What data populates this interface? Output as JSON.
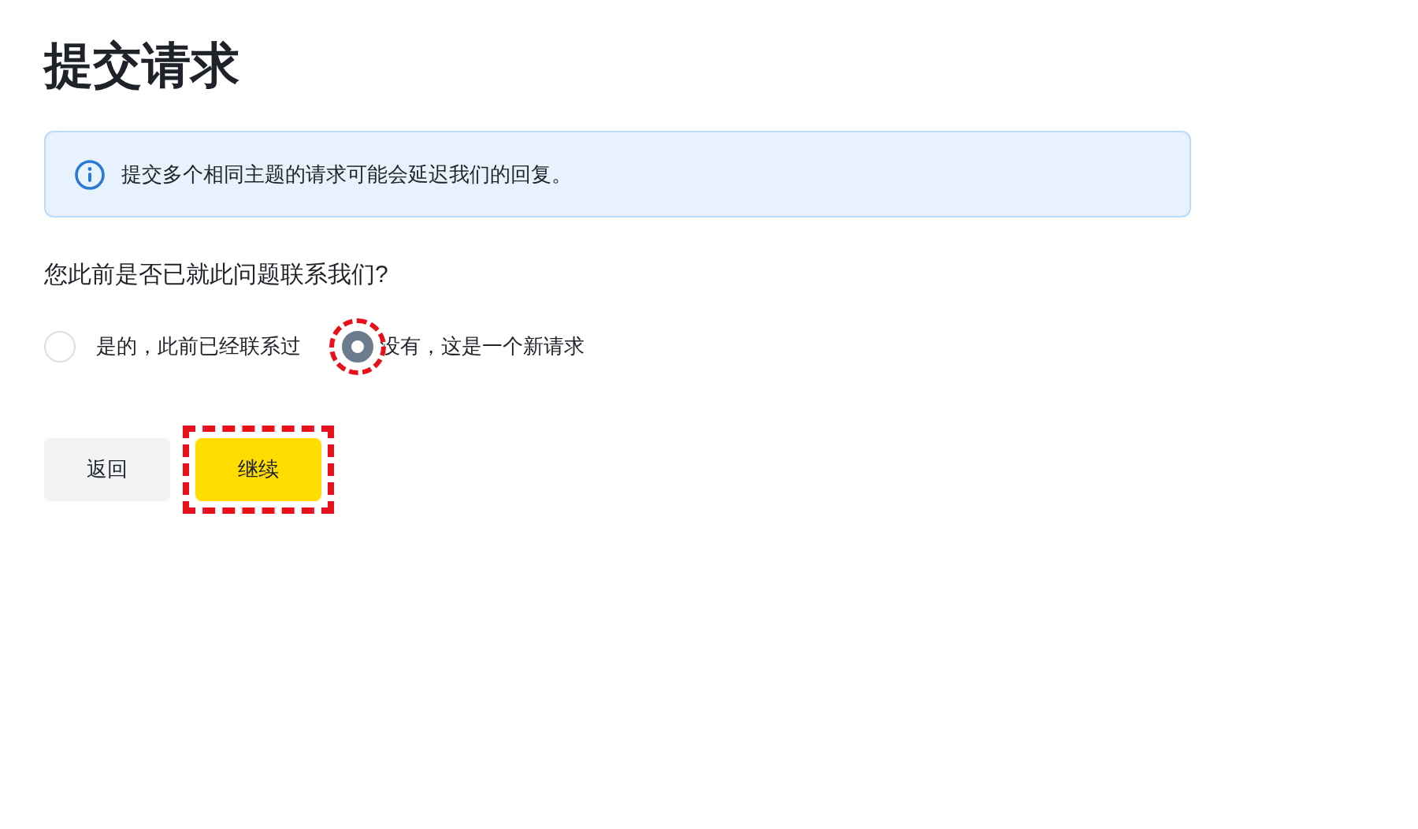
{
  "title": "提交请求",
  "notice": {
    "text": "提交多个相同主题的请求可能会延迟我们的回复。"
  },
  "question": {
    "label": "您此前是否已就此问题联系我们?",
    "options": [
      {
        "label": "是的，此前已经联系过",
        "selected": false,
        "highlighted": false
      },
      {
        "label": "没有，这是一个新请求",
        "selected": true,
        "highlighted": true
      }
    ]
  },
  "buttons": [
    {
      "label": "返回",
      "kind": "secondary",
      "highlighted": false
    },
    {
      "label": "继续",
      "kind": "primary",
      "highlighted": true
    }
  ]
}
